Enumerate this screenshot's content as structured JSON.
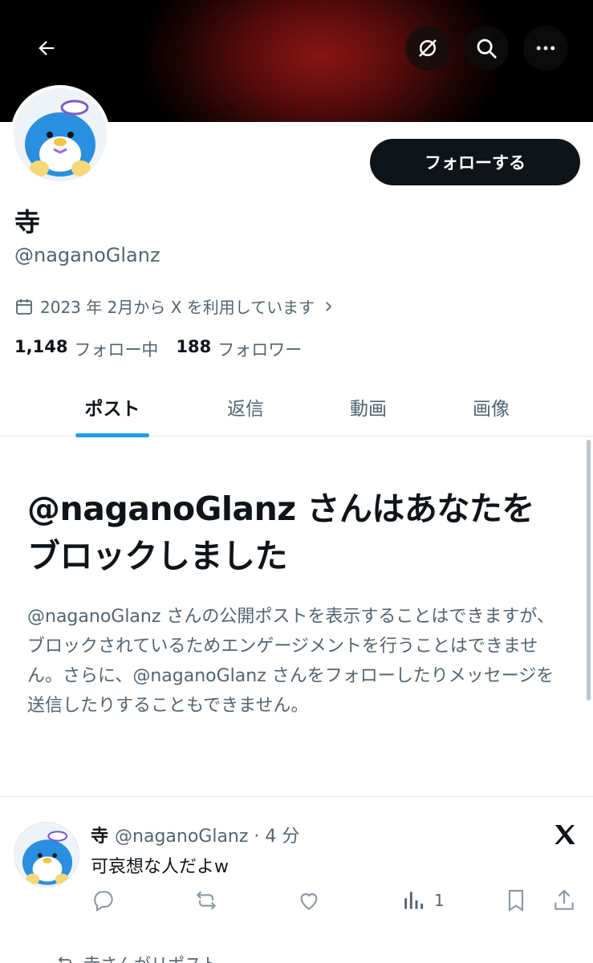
{
  "profile": {
    "display_name": "寺",
    "handle": "@naganoGlanz",
    "joined": "2023 年 2月から X を利用しています",
    "following_count": "1,148",
    "following_label": "フォロー中",
    "followers_count": "188",
    "followers_label": "フォロワー",
    "follow_button": "フォローする"
  },
  "tabs": [
    {
      "label": "ポスト",
      "active": true
    },
    {
      "label": "返信",
      "active": false
    },
    {
      "label": "動画",
      "active": false
    },
    {
      "label": "画像",
      "active": false
    }
  ],
  "blocked": {
    "title": "@naganoGlanz さんはあなたをブロックしました",
    "description": "@naganoGlanz さんの公開ポストを表示することはできますが、ブロックされているためエンゲージメントを行うことはできません。さらに、@naganoGlanz さんをフォローしたりメッセージを送信したりすることもできません。"
  },
  "tweet": {
    "name": "寺",
    "handle_time": "@naganoGlanz · 4 分",
    "text": "可哀想な人だよw",
    "views": "1"
  },
  "repost_note": "寺さんがリポスト",
  "icons": [
    "back-arrow-icon",
    "grok-icon",
    "search-icon",
    "more-icon",
    "calendar-icon",
    "chevron-right-icon",
    "x-logo-icon",
    "reply-icon",
    "repost-icon",
    "like-icon",
    "views-icon",
    "bookmark-icon",
    "share-icon"
  ],
  "colors": {
    "accent": "#1d9bf0",
    "text": "#0f1419",
    "muted": "#536471",
    "button": "#0f1419"
  }
}
